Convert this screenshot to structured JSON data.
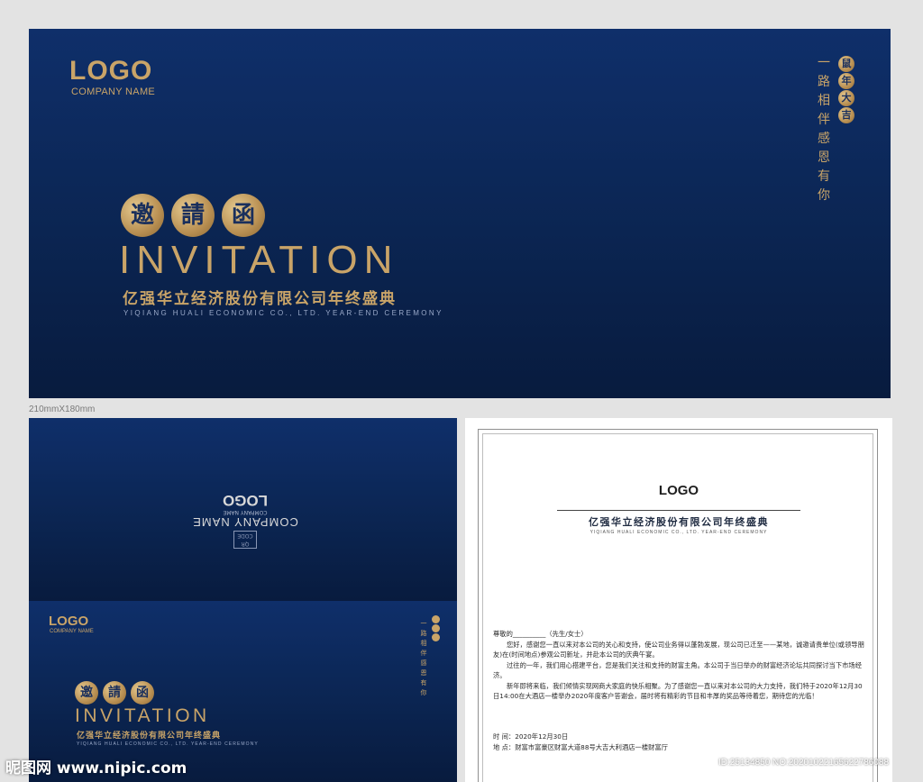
{
  "cover": {
    "logo": "LOGO",
    "company_name": "COMPANY NAME",
    "seals": [
      "邀",
      "請",
      "函"
    ],
    "invitation": "INVITATION",
    "title_cn": "亿强华立经济股份有限公司年终盛典",
    "title_en": "YIQIANG HUALI ECONOMIC CO., LTD. YEAR-END CEREMONY",
    "vertical_text": [
      "一",
      "路",
      "相",
      "伴",
      "感",
      "恩",
      "有",
      "你"
    ],
    "vertical_seals": [
      "鼠",
      "年",
      "大",
      "吉"
    ]
  },
  "dimension_label": "210mmX180mm",
  "back": {
    "qr": "QR CODE",
    "company_name": "COMPANY NAME",
    "sub": "COMPANY NAME",
    "logo": "LOGO"
  },
  "front_small": {
    "logo": "LOGO",
    "company_name": "COMPANY NAME",
    "seals": [
      "邀",
      "請",
      "函"
    ],
    "invitation": "INVITATION",
    "title_cn": "亿强华立经济股份有限公司年终盛典",
    "title_en": "YIQIANG HUALI ECONOMIC CO., LTD. YEAR-END CEREMONY",
    "vertical_text": [
      "一",
      "路",
      "相",
      "伴",
      "感",
      "恩",
      "有",
      "你"
    ]
  },
  "letter": {
    "logo": "LOGO",
    "title_cn": "亿强华立经济股份有限公司年终盛典",
    "title_en": "YIQIANG HUALI ECONOMIC CO., LTD. YEAR-END CEREMONY",
    "salutation": "尊敬的__________（先生/女士）",
    "p1": "您好，感谢您一直以来对本公司的关心和支持，使公司业务得以蓬勃发展，现公司已迁至——某地，诚邀请贵单位(或领导朋友)在(时间地点)参观公司新址，并赴本公司的庆典午宴。",
    "p2": "过往的一年，我们用心搭建平台，您是我们关注和支持的财富主角。本公司于当日举办的财富经济论坛共同探讨当下市场经济。",
    "p3": "新年即将来临，我们倾情实现网商大家庭的快乐相聚。为了感谢您一直以来对本公司的大力支持，我们特于2020年12月30日14:00在大酒店一楼举办2020年度客户答谢会，届时将有精彩的节目和丰厚的奖品等待着您，期待您的光临！",
    "time": "时  间：2020年12月30日",
    "place": "地  点：财富市富豪区财富大道88号大吉大利酒店一楼财富厅"
  },
  "watermark": {
    "left": "昵图网 www.nipic.com",
    "right": "ID:25134850 NO:20201022165622786088"
  }
}
